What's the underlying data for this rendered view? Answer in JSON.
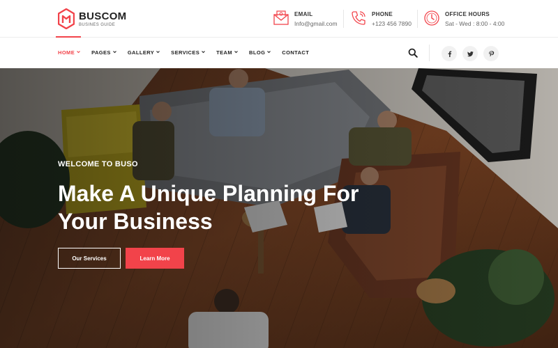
{
  "brand": {
    "name": "BUSCOM",
    "tagline": "BUSINES GUIDE",
    "accent": "#f2434a"
  },
  "contact": {
    "email": {
      "label": "EMAIL",
      "value": "Info@gmail.com",
      "icon": "envelope-icon"
    },
    "phone": {
      "label": "PHONE",
      "value": "+123 456 7890",
      "icon": "phone-icon"
    },
    "hours": {
      "label": "OFFICE HOURS",
      "value": "Sat - Wed : 8:00 - 4:00",
      "icon": "clock-icon"
    }
  },
  "nav": {
    "items": [
      {
        "label": "HOME",
        "has_dropdown": true,
        "active": true
      },
      {
        "label": "PAGES",
        "has_dropdown": true
      },
      {
        "label": "GALLERY",
        "has_dropdown": true
      },
      {
        "label": "SERVICES",
        "has_dropdown": true
      },
      {
        "label": "TEAM",
        "has_dropdown": true
      },
      {
        "label": "BLOG",
        "has_dropdown": true
      },
      {
        "label": "CONTACT",
        "has_dropdown": false
      }
    ],
    "search_icon": "search-icon",
    "social": [
      "facebook-icon",
      "twitter-icon",
      "pinterest-icon"
    ]
  },
  "hero": {
    "subtitle": "WELCOME TO BUSO",
    "title": "Make A Unique Planning For Your Business",
    "primary_button": "Our Services",
    "secondary_button": "Learn More"
  }
}
